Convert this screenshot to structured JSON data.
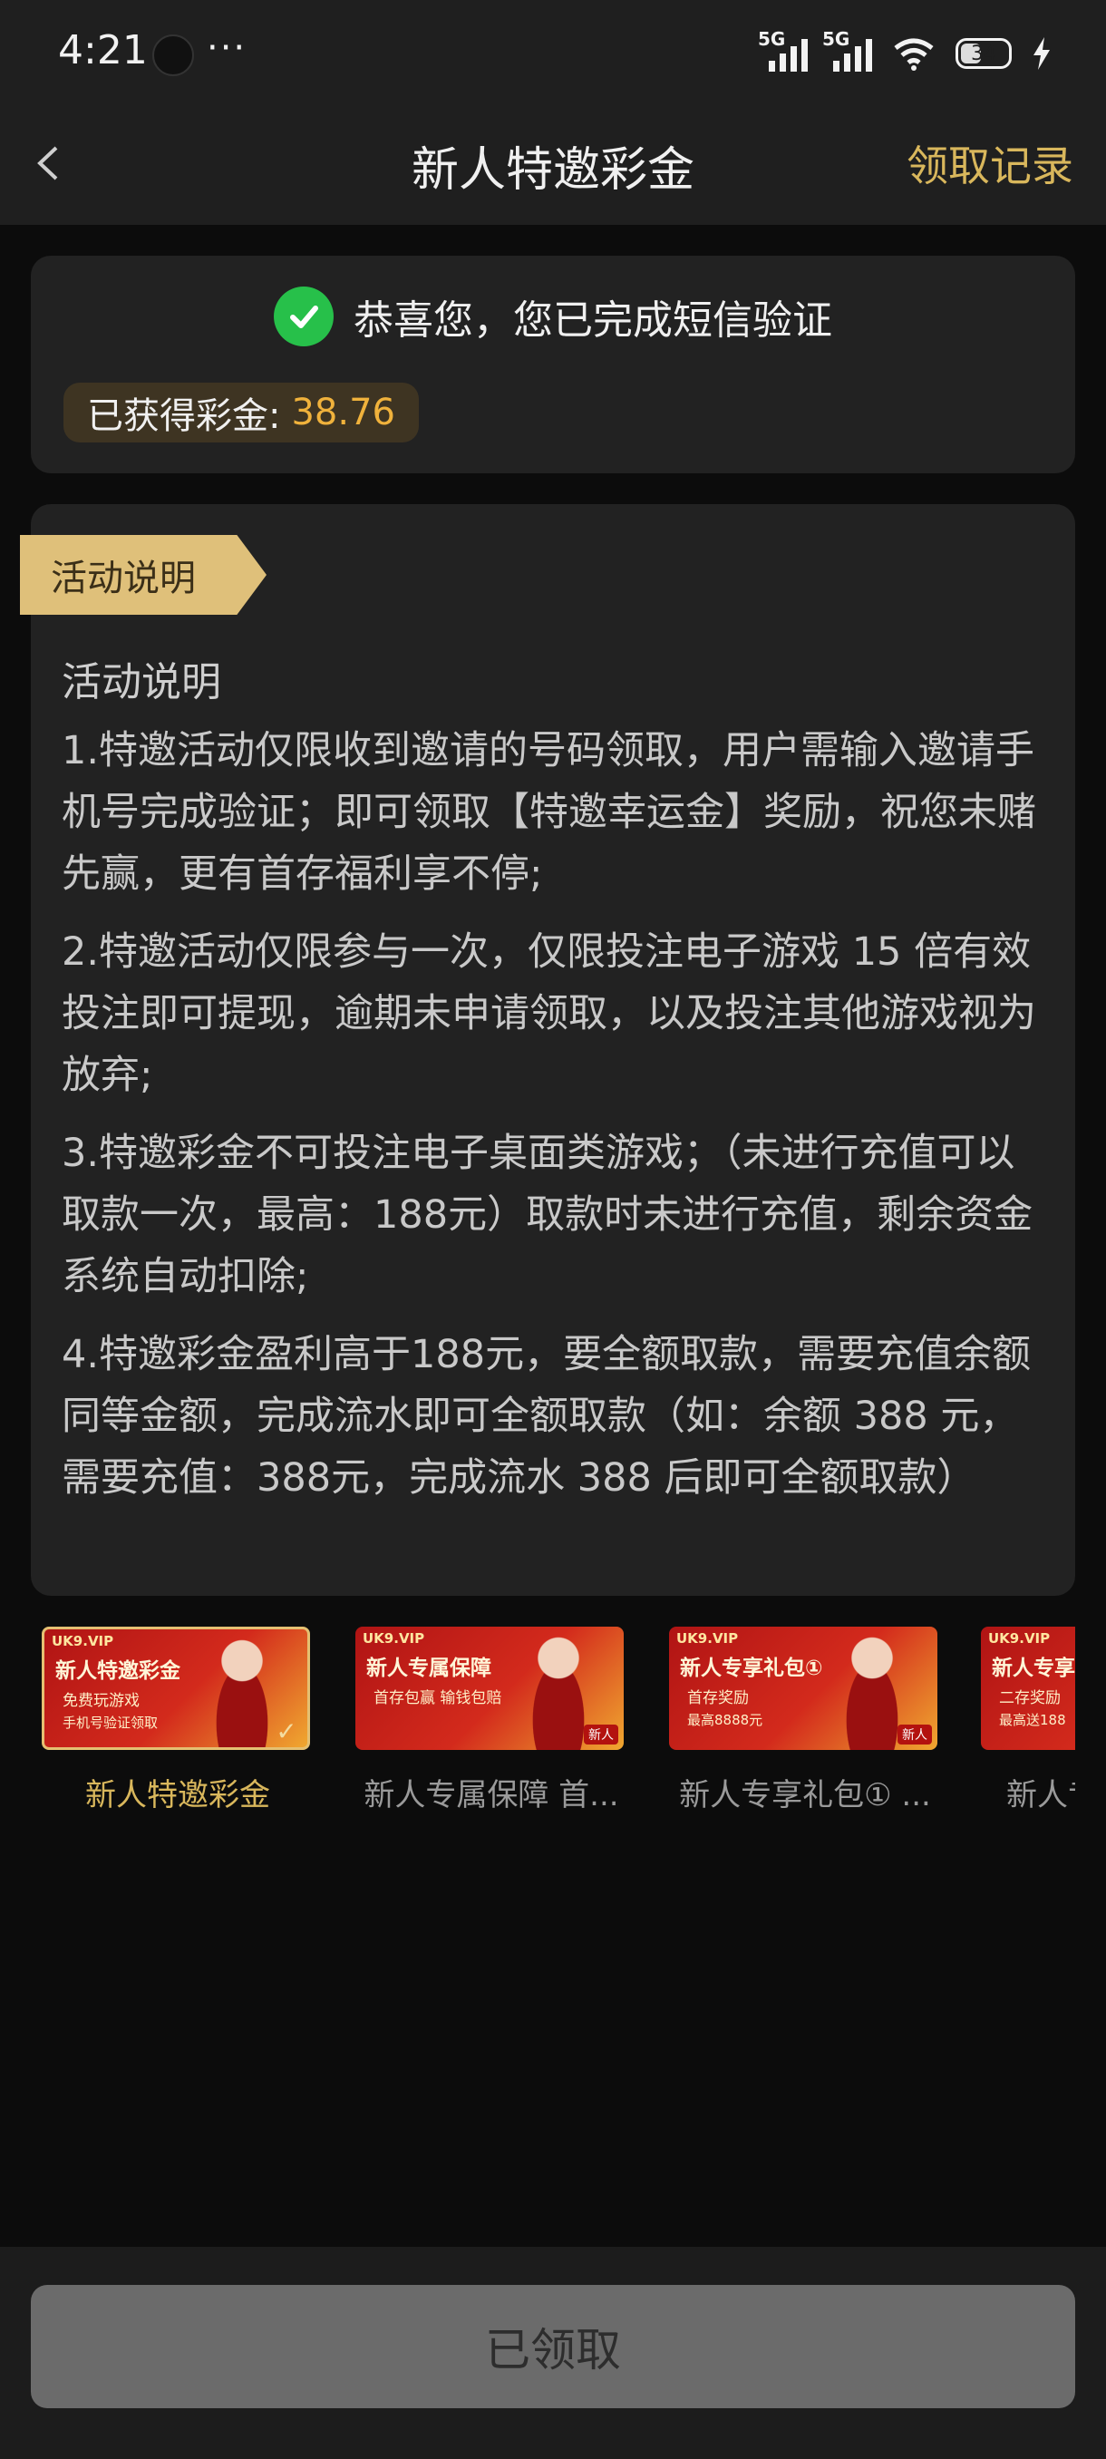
{
  "status_bar": {
    "time": "4:21",
    "more": "···",
    "signal1": "5G",
    "signal2": "5G",
    "battery": "34"
  },
  "nav": {
    "title": "新人特邀彩金",
    "action": "领取记录"
  },
  "verify": {
    "message": "恭喜您，您已完成短信验证",
    "earned_label": "已获得彩金:",
    "earned_value": "38.76"
  },
  "activity": {
    "ribbon": "活动说明",
    "heading": "活动说明",
    "rules": [
      "1.特邀活动仅限收到邀请的号码领取，用户需输入邀请手机号完成验证；即可领取【特邀幸运金】奖励，祝您未赌先赢，更有首存福利享不停;",
      "2.特邀活动仅限参与一次，仅限投注电子游戏 15 倍有效投注即可提现，逾期未申请领取，以及投注其他游戏视为放弃;",
      "3.特邀彩金不可投注电子桌面类游戏；（未进行充值可以取款一次，最高：188元）取款时未进行充值，剩余资金系统自动扣除;",
      "4.特邀彩金盈利高于188元，要全额取款，需要充值余额同等金额，完成流水即可全额取款（如：余额 388 元，需要充值：388元，完成流水 388 后即可全额取款）"
    ]
  },
  "promos": [
    {
      "caption": "新人特邀彩金",
      "vip": "UK9.VIP",
      "headline": "新人特邀彩金",
      "line1": "免费玩游戏",
      "line2": "手机号验证领取",
      "selected": true
    },
    {
      "caption": "新人专属保障 首...",
      "vip": "UK9.VIP",
      "headline": "新人专属保障",
      "line1": "首存包赢  输钱包赔",
      "line2": "",
      "badge": "新人"
    },
    {
      "caption": "新人专享礼包① ...",
      "vip": "UK9.VIP",
      "headline": "新人专享礼包①",
      "line1": "首存奖励",
      "line2": "最高8888元",
      "badge": "新人"
    },
    {
      "caption": "新人专",
      "vip": "UK9.VIP",
      "headline": "新人专享礼",
      "line1": "二存奖励",
      "line2": "最高送188"
    }
  ],
  "bottom": {
    "button": "已领取"
  },
  "colors": {
    "accent_gold": "#d9b75c",
    "earned_orange": "#f0b23c",
    "success_green": "#27c04a"
  }
}
